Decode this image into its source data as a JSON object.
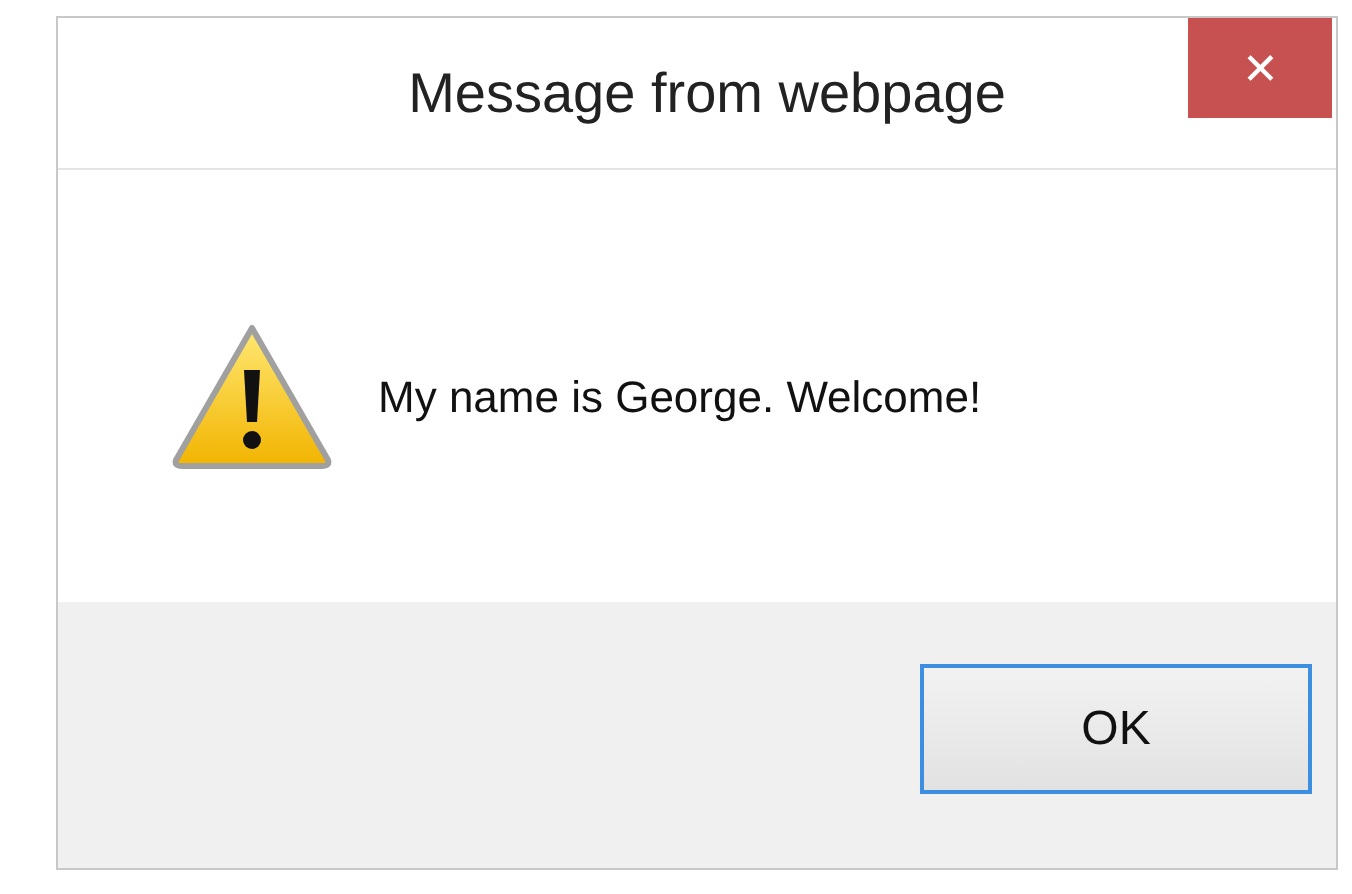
{
  "window": {
    "title": "Message from webpage",
    "close_label": "✕"
  },
  "message": "My name is George. Welcome!",
  "buttons": [
    {
      "label": "OK",
      "selected": true
    }
  ]
}
